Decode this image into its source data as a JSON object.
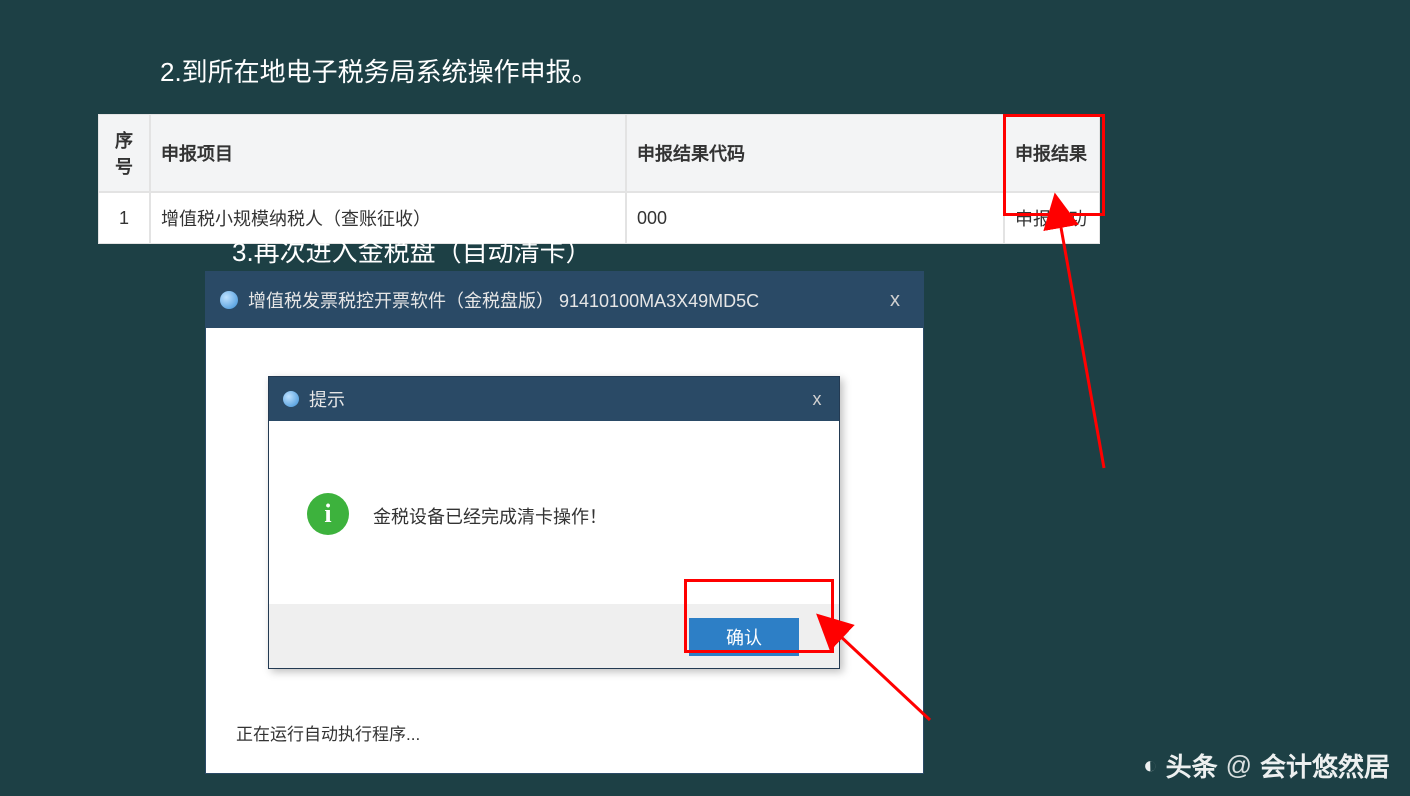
{
  "step2_heading": "2.到所在地电子税务局系统操作申报。",
  "step3_heading": "3.再次进入金税盘（自动清卡）",
  "table": {
    "headers": {
      "seq": "序号",
      "item": "申报项目",
      "code": "申报结果代码",
      "result": "申报结果"
    },
    "row": {
      "seq": "1",
      "item": "增值税小规模纳税人（查账征收）",
      "code": "000",
      "result": "申报成功"
    }
  },
  "app_window": {
    "title": "增值税发票税控开票软件（金税盘版）  91410100MA3X49MD5C",
    "close_label": "x",
    "running_text": "正在运行自动执行程序..."
  },
  "dialog": {
    "title": "提示",
    "close_label": "x",
    "message": "金税设备已经完成清卡操作！",
    "ok_label": "确认",
    "info_glyph": "i"
  },
  "watermark": {
    "brand": "头条",
    "at": "@",
    "name": "会计悠然居"
  }
}
